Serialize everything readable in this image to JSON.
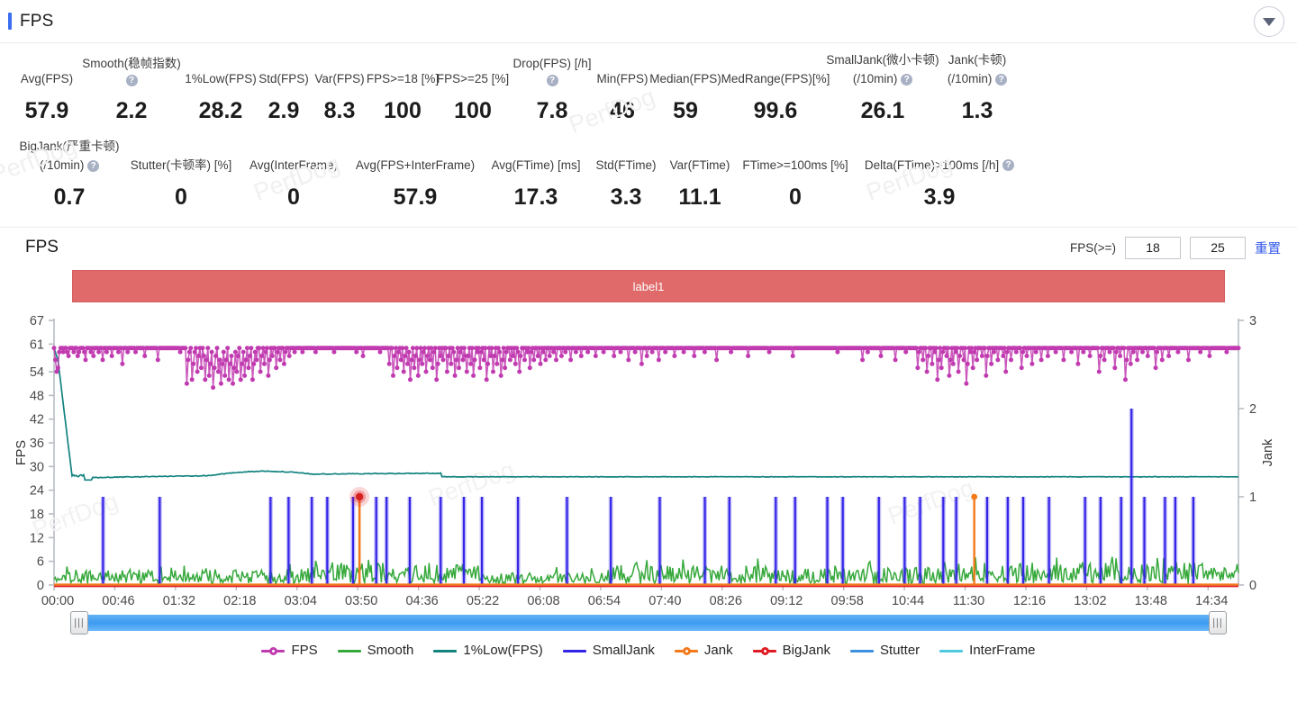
{
  "header": {
    "title": "FPS",
    "collapse_icon": "chevron-down-icon"
  },
  "watermark_text": "PerfDog",
  "metrics_row1": [
    {
      "label": "Avg(FPS)",
      "value": "57.9",
      "help": false
    },
    {
      "label": "Smooth(稳帧指数)",
      "value": "2.2",
      "help": true
    },
    {
      "label": "1%Low(FPS)",
      "value": "28.2",
      "help": false
    },
    {
      "label": "Std(FPS)",
      "value": "2.9",
      "help": false
    },
    {
      "label": "Var(FPS)",
      "value": "8.3",
      "help": false
    },
    {
      "label": "FPS>=18 [%]",
      "value": "100",
      "help": false
    },
    {
      "label": "FPS>=25 [%]",
      "value": "100",
      "help": false
    },
    {
      "label": "Drop(FPS) [/h]",
      "value": "7.8",
      "help": true
    },
    {
      "label": "Min(FPS)",
      "value": "46",
      "help": false
    },
    {
      "label": "Median(FPS)",
      "value": "59",
      "help": false
    },
    {
      "label": "MedRange(FPS)[%]",
      "value": "99.6",
      "help": false
    },
    {
      "label": "SmallJank(微小卡顿)",
      "label2": "(/10min)",
      "value": "26.1",
      "help": true
    },
    {
      "label": "Jank(卡顿)",
      "label2": "(/10min)",
      "value": "1.3",
      "help": true
    }
  ],
  "metrics_row2": [
    {
      "label": "BigJank(严重卡顿)",
      "label2": "(/10min)",
      "value": "0.7",
      "help": true
    },
    {
      "label": "Stutter(卡顿率) [%]",
      "value": "0",
      "help": false
    },
    {
      "label": "Avg(InterFrame)",
      "value": "0",
      "help": false
    },
    {
      "label": "Avg(FPS+InterFrame)",
      "value": "57.9",
      "help": false
    },
    {
      "label": "Avg(FTime) [ms]",
      "value": "17.3",
      "help": false
    },
    {
      "label": "Std(FTime)",
      "value": "3.3",
      "help": false
    },
    {
      "label": "Var(FTime)",
      "value": "11.1",
      "help": false
    },
    {
      "label": "FTime>=100ms [%]",
      "value": "0",
      "help": false
    },
    {
      "label": "Delta(FTime)>100ms [/h]",
      "value": "3.9",
      "help": true
    }
  ],
  "chart_header": {
    "title": "FPS",
    "threshold_label": "FPS(>=)",
    "threshold_low": "18",
    "threshold_high": "25",
    "reset_label": "重置"
  },
  "label_band": {
    "text": "label1",
    "color": "#e06a6a"
  },
  "slider": {
    "left_grip": "|||",
    "right_grip": "|||"
  },
  "chart_data": {
    "type": "line",
    "title": "FPS",
    "xlabel": "",
    "ylabel": "FPS",
    "y2label": "Jank",
    "ylim": [
      0,
      67
    ],
    "y2lim": [
      0,
      3
    ],
    "yticks": [
      0,
      6,
      12,
      18,
      24,
      30,
      36,
      42,
      48,
      54,
      61,
      67
    ],
    "y2ticks": [
      0,
      1,
      2,
      3
    ],
    "grid": false,
    "legend_position": "bottom",
    "xticks": [
      "00:00",
      "00:46",
      "01:32",
      "02:18",
      "03:04",
      "03:50",
      "04:36",
      "05:22",
      "06:08",
      "06:54",
      "07:40",
      "08:26",
      "09:12",
      "09:58",
      "10:44",
      "11:30",
      "12:16",
      "13:02",
      "13:48",
      "14:34"
    ],
    "x_range_seconds": [
      0,
      920
    ],
    "series": [
      {
        "name": "FPS",
        "color": "#c13bb0",
        "axis": "left",
        "marker": "circle",
        "values": [
          60,
          57,
          54,
          55,
          59,
          60,
          60,
          59,
          60,
          60,
          59,
          58,
          60,
          60,
          60,
          59,
          60,
          60,
          58,
          59,
          60,
          60,
          60,
          59,
          57,
          60,
          60,
          60,
          59,
          60,
          58,
          60,
          60,
          60,
          59,
          60,
          60,
          57,
          60,
          60,
          59,
          60,
          60,
          60,
          58,
          60,
          60,
          60,
          60,
          59,
          60,
          60,
          56,
          60,
          60,
          60,
          59,
          60,
          60,
          60,
          60,
          60,
          59,
          60,
          60,
          60,
          60,
          60,
          60,
          58,
          60,
          60,
          60,
          60,
          60,
          60,
          60,
          60,
          60,
          57,
          60,
          60,
          60,
          60,
          60,
          60,
          60,
          60,
          60,
          60,
          60,
          60,
          60,
          60,
          60,
          60,
          59,
          60,
          60,
          60,
          60,
          51,
          57,
          59,
          60,
          52,
          56,
          59,
          60,
          54,
          58,
          60,
          55,
          60,
          58,
          52,
          57,
          60,
          53,
          56,
          59,
          50,
          55,
          58,
          60,
          54,
          57,
          51,
          56,
          59,
          53,
          57,
          60,
          52,
          56,
          58,
          51,
          55,
          59,
          54,
          58,
          60,
          52,
          56,
          59,
          53,
          57,
          60,
          55,
          58,
          60,
          52,
          56,
          59,
          57,
          60,
          60,
          54,
          58,
          60,
          56,
          59,
          60,
          53,
          57,
          60,
          58,
          60,
          60,
          55,
          59,
          60,
          57,
          60,
          60,
          56,
          59,
          60,
          60,
          58,
          60,
          60,
          60,
          59,
          60,
          60,
          60,
          60,
          60,
          59,
          60,
          60,
          60,
          60,
          60,
          60,
          60,
          60,
          60,
          59,
          60,
          60,
          60,
          60,
          60,
          60,
          60,
          60,
          60,
          60,
          60,
          60,
          60,
          59,
          60,
          60,
          60,
          60,
          60,
          60,
          60,
          60,
          60,
          60,
          60,
          60,
          60,
          60,
          60,
          60,
          59,
          60,
          60,
          60,
          60,
          58,
          60,
          60,
          60,
          60,
          60,
          60,
          60,
          60,
          60,
          60,
          60,
          60,
          59,
          60,
          60,
          60,
          60,
          60,
          60,
          56,
          60,
          60,
          53,
          58,
          60,
          55,
          59,
          60,
          57,
          60,
          54,
          58,
          60,
          56,
          59,
          52,
          57,
          60,
          55,
          58,
          60,
          53,
          57,
          60,
          56,
          59,
          60,
          54,
          58,
          60,
          57,
          60,
          55,
          59,
          60,
          52,
          56,
          60,
          58,
          60,
          57,
          60,
          60,
          54,
          58,
          60,
          56,
          60,
          59,
          53,
          57,
          60,
          55,
          59,
          60,
          57,
          60,
          58,
          54,
          58,
          60,
          56,
          60,
          53,
          57,
          60,
          59,
          60,
          55,
          59,
          60,
          57,
          60,
          52,
          56,
          60,
          58,
          60,
          54,
          58,
          60,
          56,
          60,
          59,
          53,
          57,
          60,
          55,
          59,
          60,
          60,
          57,
          60,
          58,
          60,
          56,
          60,
          59,
          54,
          58,
          60,
          60,
          57,
          60,
          59,
          60,
          55,
          59,
          60,
          57,
          60,
          60,
          58,
          60,
          56,
          60,
          59,
          60,
          57,
          60,
          60,
          58,
          60,
          60,
          59,
          60,
          57,
          60,
          60,
          60,
          58,
          60,
          60,
          59,
          60,
          60,
          60,
          57,
          60,
          60,
          60,
          59,
          60,
          60,
          60,
          58,
          60,
          60,
          60,
          60,
          59,
          60,
          60,
          60,
          60,
          60,
          58,
          60,
          60,
          60,
          60,
          60,
          59,
          60,
          60,
          60,
          60,
          60,
          60,
          60,
          58,
          60,
          60,
          60,
          60,
          59,
          60,
          60,
          60,
          60,
          60,
          57,
          60,
          60,
          60,
          60,
          59,
          60,
          60,
          60,
          60,
          56,
          60,
          60,
          60,
          58,
          60,
          60,
          60,
          59,
          60,
          60,
          60,
          60,
          57,
          60,
          60,
          60,
          60,
          59,
          60,
          60,
          60,
          60,
          60,
          60,
          58,
          60,
          60,
          60,
          60,
          60,
          60,
          59,
          60,
          60,
          60,
          60,
          60,
          60,
          60,
          58,
          60,
          60,
          60,
          60,
          60,
          60,
          60,
          59,
          60,
          60,
          60,
          60,
          60,
          60,
          60,
          60,
          57,
          60,
          60,
          60,
          60,
          60,
          60,
          60,
          60,
          60,
          60,
          59,
          60,
          60,
          60,
          60,
          60,
          60,
          60,
          60,
          60,
          60,
          60,
          60,
          58,
          60,
          60,
          60,
          60,
          60,
          60,
          60,
          60,
          60,
          60,
          60,
          60,
          60,
          60,
          60,
          59,
          60,
          60,
          60,
          60,
          60,
          60,
          60,
          60,
          60,
          60,
          60,
          60,
          60,
          60,
          60,
          60,
          60,
          58,
          60,
          60,
          60,
          60,
          60,
          60,
          60,
          60,
          60,
          60,
          60,
          60,
          60,
          60,
          60,
          60,
          60,
          60,
          60,
          60,
          60,
          60,
          60,
          60,
          60,
          60,
          60,
          60,
          60,
          60,
          60,
          60,
          60,
          59,
          60,
          60,
          60,
          60,
          60,
          60,
          60,
          60,
          60,
          60,
          60,
          60,
          60,
          60,
          60,
          60,
          60,
          60,
          57,
          60,
          60,
          60,
          59,
          60,
          60,
          60,
          60,
          60,
          60,
          60,
          60,
          60,
          58,
          60,
          60,
          60,
          60,
          60,
          60,
          60,
          60,
          60,
          60,
          57,
          60,
          60,
          60,
          60,
          60,
          60,
          60,
          59,
          60,
          60,
          60,
          60,
          60,
          60,
          60,
          60,
          55,
          59,
          60,
          60,
          57,
          60,
          60,
          54,
          58,
          60,
          60,
          56,
          60,
          59,
          60,
          52,
          57,
          60,
          55,
          59,
          60,
          60,
          58,
          60,
          53,
          57,
          60,
          56,
          60,
          59,
          60,
          54,
          58,
          60,
          60,
          57,
          60,
          51,
          56,
          60,
          59,
          60,
          55,
          59,
          60,
          57,
          60,
          60,
          60,
          58,
          60,
          60,
          53,
          58,
          60,
          60,
          56,
          60,
          59,
          60,
          60,
          57,
          60,
          60,
          60,
          58,
          60,
          54,
          59,
          60,
          60,
          57,
          60,
          60,
          60,
          59,
          60,
          60,
          60,
          55,
          59,
          60,
          60,
          58,
          60,
          60,
          60,
          56,
          60,
          60,
          59,
          60,
          60,
          60,
          57,
          60,
          60,
          60,
          60,
          58,
          60,
          60,
          60,
          60,
          60,
          59,
          60,
          60,
          60,
          60,
          60,
          57,
          60,
          60,
          60,
          60,
          60,
          59,
          60,
          60,
          60,
          60,
          56,
          60,
          60,
          60,
          59,
          60,
          60,
          60,
          60,
          58,
          60,
          60,
          60,
          60,
          60,
          60,
          54,
          58,
          60,
          60,
          57,
          60,
          60,
          60,
          59,
          60,
          60,
          60,
          55,
          59,
          60,
          60,
          58,
          60,
          60,
          60,
          52,
          57,
          60,
          60,
          56,
          60,
          59,
          60,
          60,
          57,
          60,
          60,
          60,
          59,
          60,
          60,
          60,
          58,
          60,
          60,
          60,
          60,
          60,
          55,
          59,
          60,
          60,
          60,
          57,
          60,
          60,
          60,
          60,
          58,
          60,
          60,
          60,
          60,
          60,
          60,
          59,
          60,
          60,
          60,
          60,
          60,
          60,
          60,
          57,
          60,
          60,
          60,
          60,
          60,
          60,
          60,
          60,
          59,
          60,
          60,
          60,
          60,
          60,
          60,
          58,
          60,
          60,
          60,
          60,
          60,
          60,
          60,
          60,
          60,
          60,
          60,
          60,
          59,
          60,
          60,
          60,
          60,
          60,
          60,
          60,
          60,
          60
        ]
      },
      {
        "name": "Smooth",
        "color": "#37a93c",
        "axis": "left",
        "marker": "none",
        "note": "low amplitude jagged series oscillating 0-7 FPS units across full range"
      },
      {
        "name": "1%Low(FPS)",
        "color": "#12837f",
        "axis": "left",
        "marker": "none",
        "note": "starts near 60, drops steeply to ~28 by 00:10 then flat ~27-29 for the remainder"
      },
      {
        "name": "SmallJank",
        "color": "#3424e8",
        "axis": "right",
        "marker": "none",
        "note": "sparse unit impulses reaching 1 on Jank axis, ~40 spikes; one spike reaches 2 near 14:20"
      },
      {
        "name": "Jank",
        "color": "#f3791a",
        "axis": "right",
        "marker": "circle",
        "note": "baseline 0 with a single impulse reaching 1 near 11:34"
      },
      {
        "name": "BigJank",
        "color": "#e01b24",
        "axis": "right",
        "marker": "circle",
        "note": "baseline 0 with one highlighted impulse reaching 1 at 03:50"
      },
      {
        "name": "Stutter",
        "color": "#3d8fe0",
        "axis": "right",
        "marker": "none",
        "note": "flat at 0"
      },
      {
        "name": "InterFrame",
        "color": "#4fc8e0",
        "axis": "right",
        "marker": "none",
        "note": "flat at 0"
      }
    ],
    "highlighted_point": {
      "series": "BigJank",
      "x": "03:50",
      "y": 1,
      "color": "#e01b24"
    },
    "legend": [
      "FPS",
      "Smooth",
      "1%Low(FPS)",
      "SmallJank",
      "Jank",
      "BigJank",
      "Stutter",
      "InterFrame"
    ]
  }
}
